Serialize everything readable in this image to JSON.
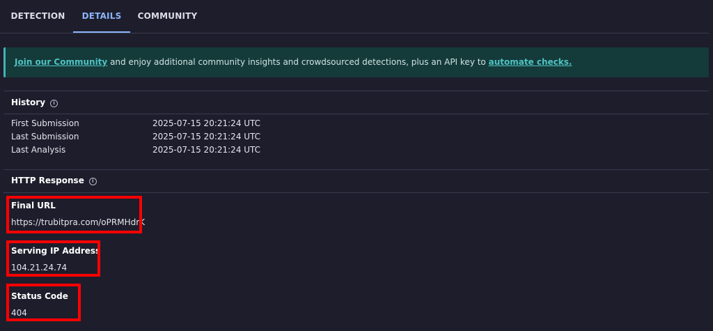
{
  "tabs": [
    {
      "label": "DETECTION"
    },
    {
      "label": "DETAILS"
    },
    {
      "label": "COMMUNITY"
    }
  ],
  "banner": {
    "link1": "Join our Community",
    "text": " and enjoy additional community insights and crowdsourced detections, plus an API key to ",
    "link2": "automate checks."
  },
  "history": {
    "title": "History",
    "rows": [
      {
        "label": "First Submission",
        "value": "2025-07-15 20:21:24 UTC"
      },
      {
        "label": "Last Submission",
        "value": "2025-07-15 20:21:24 UTC"
      },
      {
        "label": "Last Analysis",
        "value": "2025-07-15 20:21:24 UTC"
      }
    ]
  },
  "http_response": {
    "title": "HTTP Response",
    "final_url_label": "Final URL",
    "final_url_value": "https://trubitpra.com/oPRMHdrK",
    "ip_label": "Serving IP Address",
    "ip_value": "104.21.24.74",
    "status_label": "Status Code",
    "status_value": "404"
  },
  "colors": {
    "background": "#1e1d2c",
    "active_tab": "#8ab4f8",
    "banner_bg": "#153a3a",
    "link": "#4fc3c3",
    "highlight": "#ff0000"
  }
}
